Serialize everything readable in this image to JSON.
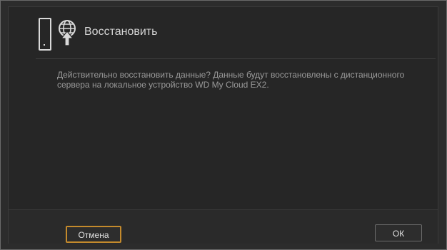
{
  "dialog": {
    "title": "Восстановить",
    "message": "Действительно восстановить данные? Данные будут восстановлены с дистанционного сервера на локальное устройство WD My Cloud EX2.",
    "cancel_label": "Отмена",
    "ok_label": "ОК",
    "icons": [
      "device-icon",
      "globe-restore-icon"
    ],
    "colors": {
      "background": "#262626",
      "title_text": "#d6d6d6",
      "body_text": "#9a9a9a",
      "focus_border": "#c48a2c"
    }
  }
}
